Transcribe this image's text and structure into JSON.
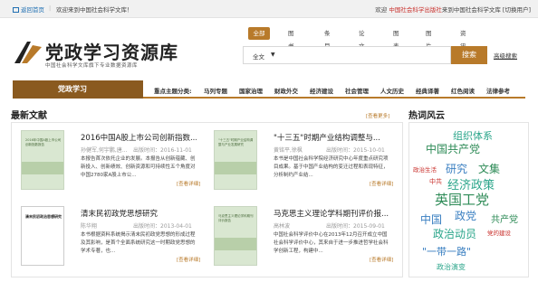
{
  "topbar": {
    "home": "返回首页",
    "welcome": "欢迎来到中国社会科学文库！",
    "right_prefix": "欢迎",
    "right_org": "中国社会科学出版社",
    "right_suffix": "来到中国社会科学文库",
    "switch_user": "[切换用户]"
  },
  "logo": {
    "title": "党政学习资源库",
    "subtitle": "中国社会科学文库旗下专业数据资源库"
  },
  "search": {
    "tabs": [
      "全部",
      "图书",
      "条目",
      "论文",
      "图表",
      "图片",
      "资讯"
    ],
    "field": "全文",
    "caret": "▼",
    "placeholder": "",
    "button": "搜索",
    "advanced": "高级搜索"
  },
  "nav": {
    "brand": "党政学习",
    "label": "重点主题分类:",
    "categories": [
      "马列专题",
      "国家治理",
      "财政外交",
      "经济建设",
      "社会管理",
      "人文历史",
      "经典译著",
      "红色阅读",
      "法律参考"
    ]
  },
  "latest": {
    "title": "最新文献",
    "more": "[查看更多]",
    "items": [
      {
        "cover_title": "2016年中国A股上市公司创新指数报告",
        "title": "2016中国A股上市公司创新指数...",
        "author": "孙健军,何宇鹏,唐...",
        "date": "出版时间：2016-11-01",
        "summary": "本报告首次依托企业的发展。本报告从创新蕴藏、创新投入、创新绩效、创新资源和可持续性五个角度对中国2780家A股上市公...",
        "detail": "[查看详细]"
      },
      {
        "cover_title": "\"十三五\"时期产业结构调整与产业发展研究",
        "title": "\"十三五\"时期产业结构调整与...",
        "author": "黄铭平,徐枫",
        "date": "出版时间：2015-10-01",
        "summary": "本书是中国社会科学院经济研究中心年度重点研究项目成果。基于中国产业结构的变迁过程和表现特征，分析制约产业结...",
        "detail": "[查看详细]"
      },
      {
        "cover_title": "清末民初政治思想研究",
        "title": "清末民初政党思想研究",
        "author": "陈华翔",
        "date": "出版时间：2013-04-01",
        "summary": "本书根据资料系统揭示清末民初政党思想的形成过程及其影响，是首个全面系统研究这一时期政党思想的学术专著，也...",
        "detail": "[查看详细]"
      },
      {
        "cover_title": "马克思主义理论学科期刊评价报告",
        "title": "马克思主义理论学科期刊评价报...",
        "author": "高林波",
        "date": "出版时间：2015-09-01",
        "summary": "中国社会科学评价中心在2013年12月召开成立中国社会科学评价中心，其来自于进一步推进哲学社会科学创新工程，构建中...",
        "detail": "[查看详细]"
      }
    ]
  },
  "cloud": {
    "title": "热词风云",
    "words": [
      "组织体系",
      "中国共产党",
      "政治生活",
      "研究",
      "文集",
      "中共",
      "经济政策",
      "英国工党",
      "中国",
      "政党",
      "共产党",
      "政治动员",
      "党的建设",
      "\"一带一路\"",
      "政治演变"
    ]
  },
  "colors": {
    "accent": "#b87a2a",
    "brand_dark": "#8a5a1f",
    "link_blue": "#1f6fb2",
    "cloud_teal": "#2aa58a",
    "cloud_green": "#2e8b57",
    "cloud_blue": "#3a7fc1",
    "cloud_red": "#c9302c"
  }
}
